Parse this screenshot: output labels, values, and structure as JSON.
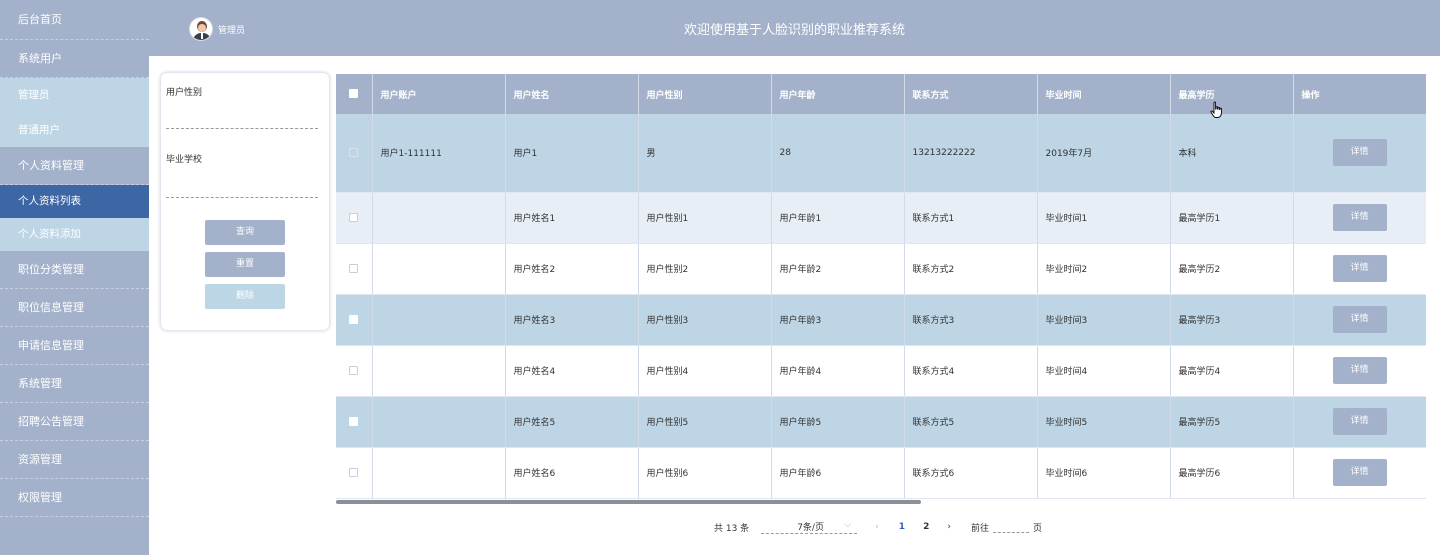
{
  "sidebar": {
    "items": [
      {
        "label": "后台首页"
      },
      {
        "label": "系统用户"
      },
      {
        "label": "管理员"
      },
      {
        "label": "普通用户"
      },
      {
        "label": "个人资料管理"
      },
      {
        "label": "个人资料列表"
      },
      {
        "label": "个人资料添加"
      },
      {
        "label": "职位分类管理"
      },
      {
        "label": "职位信息管理"
      },
      {
        "label": "申请信息管理"
      },
      {
        "label": "系统管理"
      },
      {
        "label": "招聘公告管理"
      },
      {
        "label": "资源管理"
      },
      {
        "label": "权限管理"
      }
    ]
  },
  "header": {
    "user_name": "管理员",
    "title": "欢迎使用基于人脸识别的职业推荐系统"
  },
  "search": {
    "gender_label": "用户性别",
    "school_label": "毕业学校",
    "query_btn": "查询",
    "reset_btn": "重置",
    "delete_btn": "删除"
  },
  "table": {
    "headers": [
      "用户账户",
      "用户姓名",
      "用户性别",
      "用户年龄",
      "联系方式",
      "毕业时间",
      "最高学历",
      "操作"
    ],
    "detail_label": "详情",
    "rows": [
      [
        "用户1-111111",
        "用户1",
        "男",
        "28",
        "13213222222",
        "2019年7月",
        "本科"
      ],
      [
        "",
        "用户姓名1",
        "用户性别1",
        "用户年龄1",
        "联系方式1",
        "毕业时间1",
        "最高学历1"
      ],
      [
        "",
        "用户姓名2",
        "用户性别2",
        "用户年龄2",
        "联系方式2",
        "毕业时间2",
        "最高学历2"
      ],
      [
        "",
        "用户姓名3",
        "用户性别3",
        "用户年龄3",
        "联系方式3",
        "毕业时间3",
        "最高学历3"
      ],
      [
        "",
        "用户姓名4",
        "用户性别4",
        "用户年龄4",
        "联系方式4",
        "毕业时间4",
        "最高学历4"
      ],
      [
        "",
        "用户姓名5",
        "用户性别5",
        "用户年龄5",
        "联系方式5",
        "毕业时间5",
        "最高学历5"
      ],
      [
        "",
        "用户姓名6",
        "用户性别6",
        "用户年龄6",
        "联系方式6",
        "毕业时间6",
        "最高学历6"
      ]
    ]
  },
  "pager": {
    "total": "共 13 条",
    "page_size": "7条/页",
    "pages": [
      "1",
      "2"
    ],
    "goto": "前往",
    "page_unit": "页"
  },
  "colors": {
    "primary": "#a3b1ca",
    "active": "#3d66a5",
    "light_blue": "#bdd5e5",
    "page_active": "#2f65c2"
  }
}
